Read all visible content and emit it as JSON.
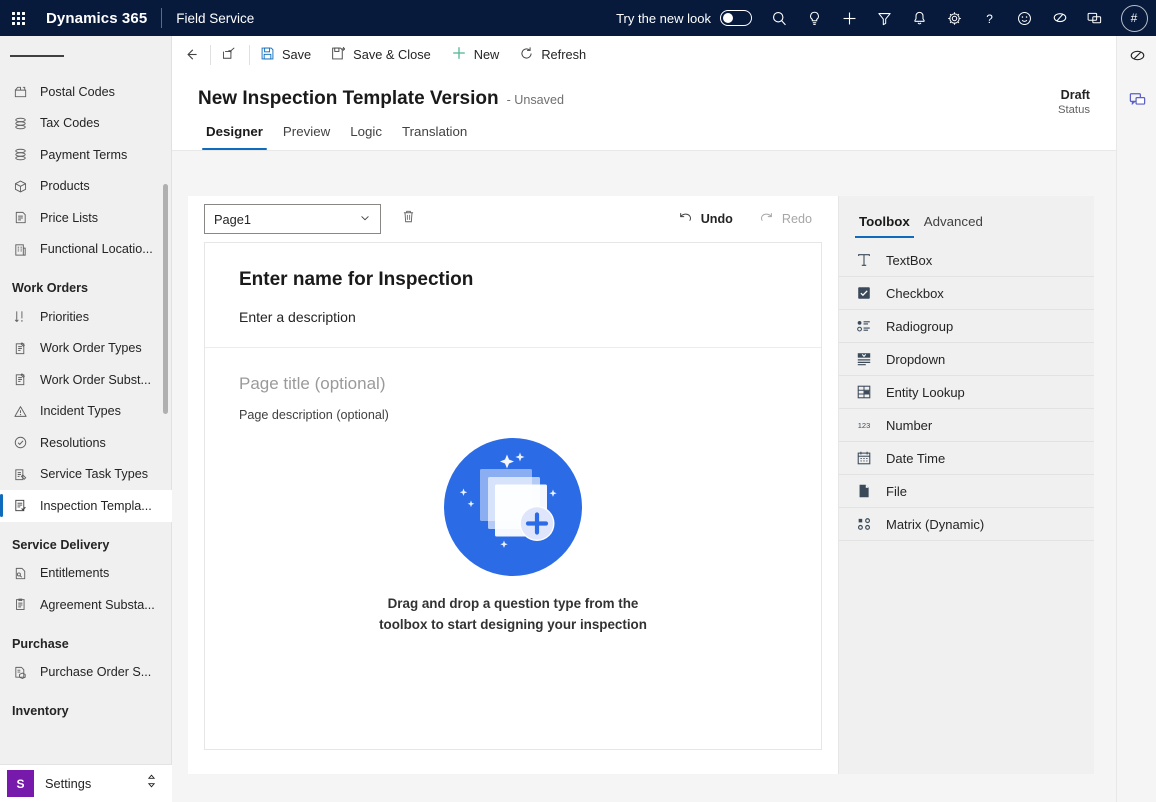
{
  "header": {
    "waffle_label": "app-launcher",
    "brand": "Dynamics 365",
    "app_name": "Field Service",
    "new_look_label": "Try the new look",
    "new_look_on": false,
    "icons": [
      {
        "name": "search-icon",
        "title": "Search"
      },
      {
        "name": "lightbulb-icon",
        "title": "Insights"
      },
      {
        "name": "quick-create-icon",
        "title": "New"
      },
      {
        "name": "filter-icon",
        "title": "Filter"
      },
      {
        "name": "bell-icon",
        "title": "Notifications"
      },
      {
        "name": "gear-icon",
        "title": "Settings"
      },
      {
        "name": "help-icon",
        "title": "Help"
      },
      {
        "name": "smiley-icon",
        "title": "Feedback"
      },
      {
        "name": "copilot-icon",
        "title": "Copilot"
      },
      {
        "name": "chat-icon",
        "title": "Chat"
      }
    ],
    "avatar_initials": "#"
  },
  "sidebar": {
    "items": [
      {
        "label": "Postal Codes",
        "icon": "postal-codes-icon",
        "selected": false
      },
      {
        "label": "Tax Codes",
        "icon": "tax-codes-icon",
        "selected": false
      },
      {
        "label": "Payment Terms",
        "icon": "payment-terms-icon",
        "selected": false
      },
      {
        "label": "Products",
        "icon": "products-icon",
        "selected": false
      },
      {
        "label": "Price Lists",
        "icon": "price-lists-icon",
        "selected": false
      },
      {
        "label": "Functional Locatio...",
        "icon": "functional-locations-icon",
        "selected": false
      }
    ],
    "group_work_orders": "Work Orders",
    "work_orders_items": [
      {
        "label": "Priorities",
        "icon": "priorities-icon",
        "selected": false
      },
      {
        "label": "Work Order Types",
        "icon": "work-order-types-icon",
        "selected": false
      },
      {
        "label": "Work Order Subst...",
        "icon": "work-order-substatus-icon",
        "selected": false
      },
      {
        "label": "Incident Types",
        "icon": "incident-types-icon",
        "selected": false
      },
      {
        "label": "Resolutions",
        "icon": "resolutions-icon",
        "selected": false
      },
      {
        "label": "Service Task Types",
        "icon": "service-task-types-icon",
        "selected": false
      },
      {
        "label": "Inspection Templa...",
        "icon": "inspection-templates-icon",
        "selected": true
      }
    ],
    "group_service_delivery": "Service Delivery",
    "service_delivery_items": [
      {
        "label": "Entitlements",
        "icon": "entitlements-icon",
        "selected": false
      },
      {
        "label": "Agreement Substa...",
        "icon": "agreement-substatus-icon",
        "selected": false
      }
    ],
    "group_purchase": "Purchase",
    "purchase_items": [
      {
        "label": "Purchase Order S...",
        "icon": "purchase-order-icon",
        "selected": false
      }
    ],
    "group_inventory": "Inventory",
    "settings": {
      "badge": "S",
      "label": "Settings"
    }
  },
  "commandbar": {
    "back": "back-arrow",
    "popout": "pop-out",
    "buttons": [
      {
        "label": "Save",
        "icon": "save-icon"
      },
      {
        "label": "Save & Close",
        "icon": "save-close-icon"
      },
      {
        "label": "New",
        "icon": "plus-icon"
      },
      {
        "label": "Refresh",
        "icon": "refresh-icon"
      }
    ]
  },
  "record": {
    "title": "New Inspection Template Version",
    "subtitle": "- Unsaved",
    "status_value": "Draft",
    "status_label": "Status"
  },
  "tabs": [
    {
      "label": "Designer",
      "active": true
    },
    {
      "label": "Preview",
      "active": false
    },
    {
      "label": "Logic",
      "active": false
    },
    {
      "label": "Translation",
      "active": false
    }
  ],
  "designer": {
    "page_select_value": "Page1",
    "delete_icon": "trash-icon",
    "undo_label": "Undo",
    "redo_label": "Redo",
    "undo_enabled": true,
    "redo_enabled": false,
    "canvas": {
      "inspection_name_placeholder": "Enter name for Inspection",
      "inspection_description_placeholder": "Enter a description",
      "page_title_placeholder": "Page title (optional)",
      "page_description_placeholder": "Page description (optional)",
      "empty_state_text": "Drag and drop a question type from the toolbox to start designing your inspection",
      "illustration_color": "#2B6CE6",
      "illustration_name": "add-cards-illustration"
    }
  },
  "toolbox": {
    "tabs": [
      {
        "label": "Toolbox",
        "active": true
      },
      {
        "label": "Advanced",
        "active": false
      }
    ],
    "items": [
      {
        "label": "TextBox",
        "icon": "textbox-icon"
      },
      {
        "label": "Checkbox",
        "icon": "checkbox-icon"
      },
      {
        "label": "Radiogroup",
        "icon": "radiogroup-icon"
      },
      {
        "label": "Dropdown",
        "icon": "dropdown-icon"
      },
      {
        "label": "Entity Lookup",
        "icon": "entity-lookup-icon"
      },
      {
        "label": "Number",
        "icon": "number-icon"
      },
      {
        "label": "Date Time",
        "icon": "date-time-icon"
      },
      {
        "label": "File",
        "icon": "file-icon"
      },
      {
        "label": "Matrix (Dynamic)",
        "icon": "matrix-dynamic-icon"
      }
    ]
  },
  "rightrail": {
    "buttons": [
      {
        "name": "copilot-icon"
      },
      {
        "name": "chat-panel-icon"
      }
    ]
  },
  "colors": {
    "header_bg": "#071A3C",
    "accent": "#0f6cbd",
    "sidebar_bg": "#f0f0f0",
    "settings_badge": "#7719aa",
    "illustration": "#2B6CE6"
  }
}
